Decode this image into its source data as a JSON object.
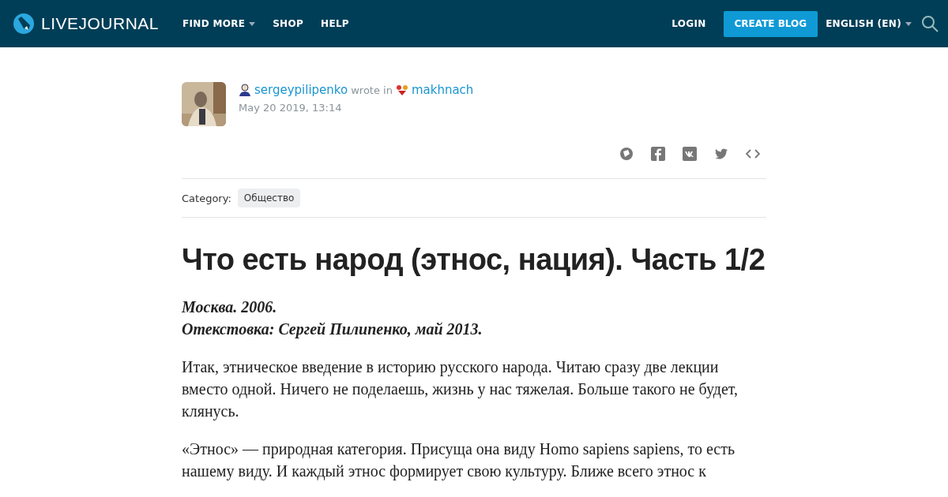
{
  "header": {
    "logo": "LIVEJOURNAL",
    "nav": [
      {
        "label": "FIND MORE",
        "dropdown": true
      },
      {
        "label": "SHOP",
        "dropdown": false
      },
      {
        "label": "HELP",
        "dropdown": false
      }
    ],
    "login": "LOGIN",
    "create": "CREATE BLOG",
    "language": "ENGLISH (EN)"
  },
  "post": {
    "author": "sergeypilipenko",
    "wrote_in": "wrote in",
    "community": "makhnach",
    "date": "May 20 2019, 13:14",
    "category_label": "Category:",
    "category": "Общество",
    "title": "Что есть народ (этнос, нация). Часть 1/2",
    "intro": [
      "Москва. 2006.",
      "Отекстовка: Сергей Пилипенко, май 2013."
    ],
    "paragraphs": [
      "Итак, этническое введение в историю русского народа. Читаю сразу две лекции вместо одной. Ничего не поделаешь, жизнь у нас тяжелая. Больше такого не будет, клянусь.",
      "«Этнос» — природная категория. Присуща она виду Homo sapiens sapiens, то есть нашему виду. И каждый этнос формирует свою культуру. Ближе всего этнос к"
    ]
  }
}
